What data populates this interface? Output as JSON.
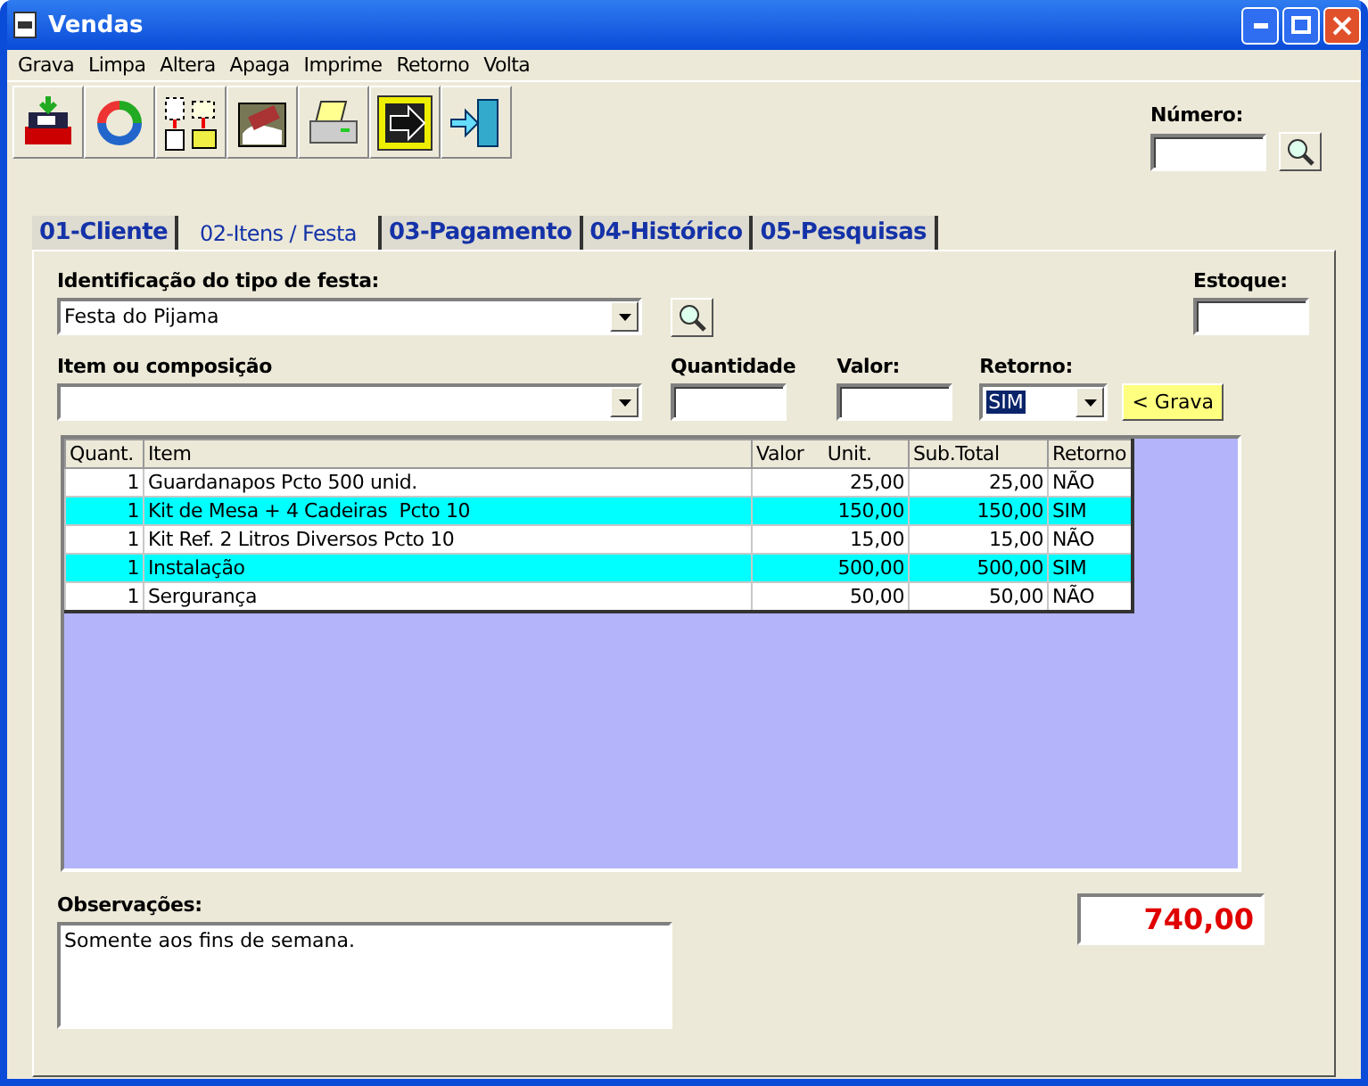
{
  "window": {
    "title": "Vendas"
  },
  "menu": [
    "Grava",
    "Limpa",
    "Altera",
    "Apaga",
    "Imprime",
    "Retorno",
    "Volta"
  ],
  "toolbar": [
    {
      "kind": "save"
    },
    {
      "kind": "refresh"
    },
    {
      "kind": "copy"
    },
    {
      "kind": "erase"
    },
    {
      "kind": "print"
    },
    {
      "kind": "export"
    },
    {
      "kind": "exit"
    }
  ],
  "numero": {
    "label": "Número:"
  },
  "tabs": [
    {
      "label": "01-Cliente",
      "selected": false
    },
    {
      "label": "02-Itens / Festa",
      "selected": true
    },
    {
      "label": "03-Pagamento",
      "selected": false
    },
    {
      "label": "04-Histórico",
      "selected": false
    },
    {
      "label": "05-Pesquisas",
      "selected": false
    }
  ],
  "festa": {
    "label": "Identificação do tipo de festa:",
    "value": "Festa do Pijama"
  },
  "estoque": {
    "label": "Estoque:"
  },
  "item": {
    "label": "Item ou composição"
  },
  "quantidade": {
    "label": "Quantidade"
  },
  "valor": {
    "label": "Valor:"
  },
  "retorno": {
    "label": "Retorno:",
    "value": "SIM"
  },
  "grava_button": "< Grava",
  "table": {
    "columns": [
      "Quant.",
      "Item",
      "Valor    Unit.",
      "Sub.Total",
      "Retorno"
    ],
    "rows": [
      {
        "cells": [
          "1",
          "Guardanapos Pcto 500 unid.",
          "25,00",
          "25,00",
          "NÃO"
        ],
        "highlighted": false
      },
      {
        "cells": [
          "1",
          "Kit de Mesa + 4 Cadeiras  Pcto 10",
          "150,00",
          "150,00",
          "SIM"
        ],
        "highlighted": true
      },
      {
        "cells": [
          "1",
          "Kit Ref. 2 Litros Diversos Pcto 10",
          "15,00",
          "15,00",
          "NÃO"
        ],
        "highlighted": false
      },
      {
        "cells": [
          "1",
          "Instalação",
          "500,00",
          "500,00",
          "SIM"
        ],
        "highlighted": true
      },
      {
        "cells": [
          "1",
          "Sergurança",
          "50,00",
          "50,00",
          "NÃO"
        ],
        "highlighted": false
      }
    ]
  },
  "observacoes": {
    "label": "Observações:",
    "value": "Somente aos fins de semana."
  },
  "total": "740,00"
}
